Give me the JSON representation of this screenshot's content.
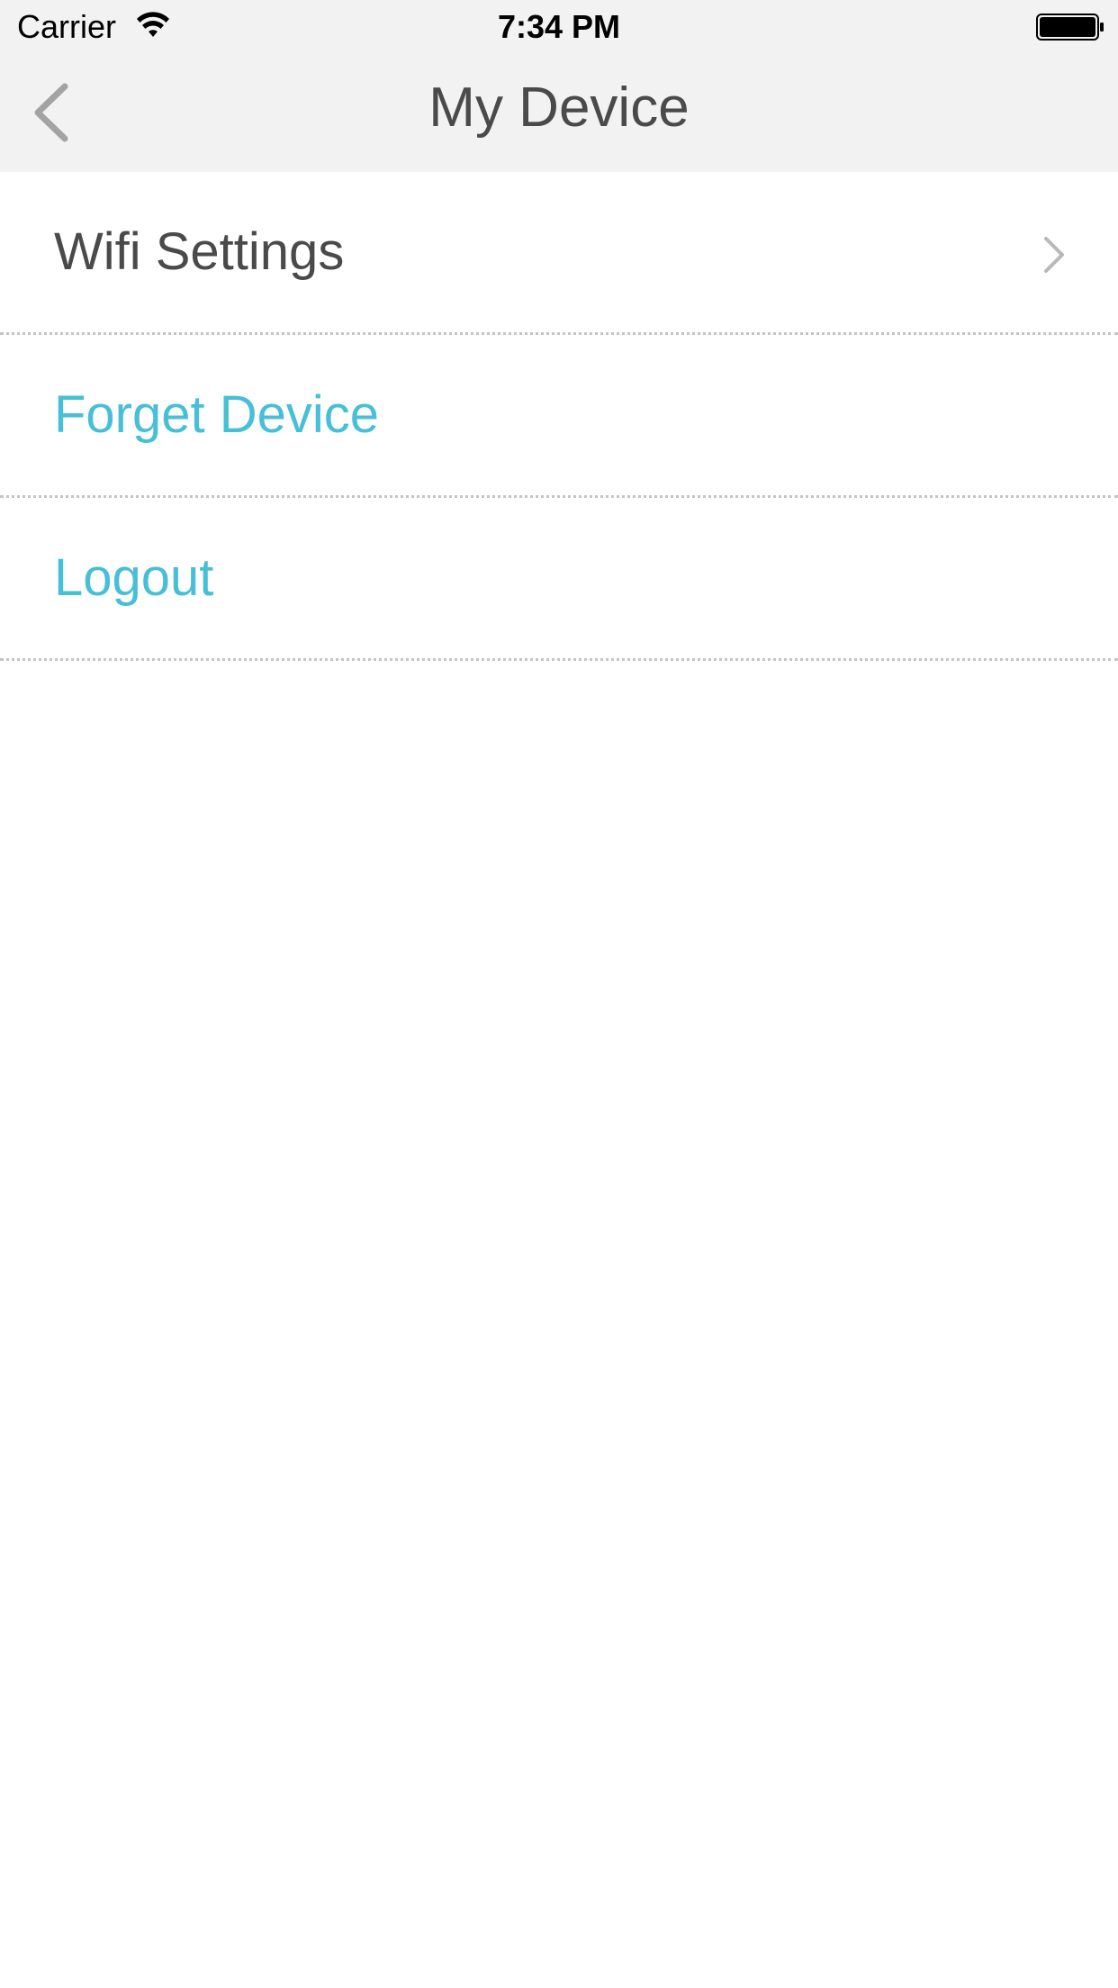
{
  "status_bar": {
    "carrier": "Carrier",
    "time": "7:34 PM",
    "wifi_icon": "wifi-icon",
    "battery_icon": "battery-full-icon"
  },
  "nav": {
    "title": "My Device",
    "back_icon": "chevron-left-icon"
  },
  "menu": {
    "items": [
      {
        "label": "Wifi Settings",
        "color": "#4a4a4a",
        "accessory": "chevron-right-icon"
      },
      {
        "label": "Forget Device",
        "color": "#47bfd6"
      },
      {
        "label": "Logout",
        "color": "#47bfd6"
      }
    ]
  },
  "colors": {
    "header_background": "#f2f2f2",
    "accent": "#47bfd6",
    "text_primary": "#4a4a4a",
    "separator": "#c4c4c4"
  }
}
